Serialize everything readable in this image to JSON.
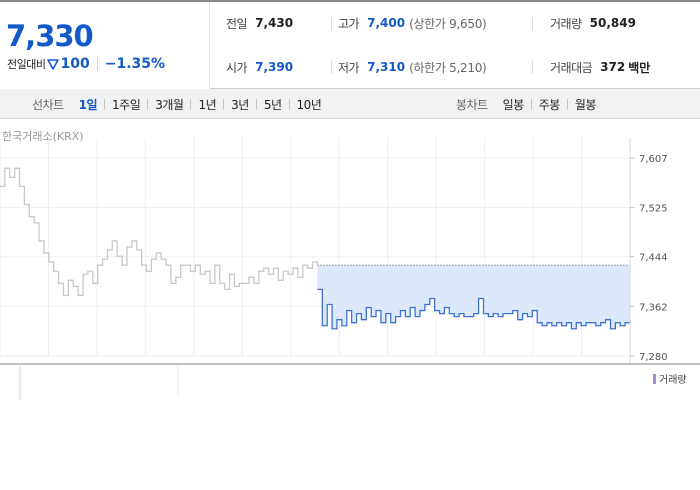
{
  "quote": {
    "current_price": "7,330",
    "change_label": "전일대비",
    "change_value": "100",
    "change_rate": "−1.35%",
    "prev_close_label": "전일",
    "prev_close": "7,430",
    "high_label": "고가",
    "high": "7,400",
    "upper_limit": "(상한가 9,650)",
    "volume_label": "거래량",
    "volume": "50,849",
    "open_label": "시가",
    "open": "7,390",
    "low_label": "저가",
    "low": "7,310",
    "lower_limit": "(하한가 5,210)",
    "amount_label": "거래대금",
    "amount": "372",
    "amount_unit": "백만",
    "colors": {
      "down": "#1259c9",
      "up": "#e33"
    }
  },
  "toolbar": {
    "line_chart_label": "선차트",
    "periods": [
      "1일",
      "1주일",
      "3개월",
      "1년",
      "3년",
      "5년",
      "10년"
    ],
    "active_period": "1일",
    "candle_chart_label": "봉차트",
    "candle_periods": [
      "일봉",
      "주봉",
      "월봉"
    ]
  },
  "chart_data": {
    "type": "line",
    "source_label": "한국거래소(KRX)",
    "ylim": [
      7280,
      7607
    ],
    "yticks": [
      7607,
      7525,
      7444,
      7362,
      7280
    ],
    "prev_close_reference": 7430,
    "grid": true,
    "legend_position": "bottom-right",
    "series": [
      {
        "name": "",
        "color": "#c8c8c8",
        "x": [
          0,
          0.5,
          1,
          1.5,
          2,
          2.5,
          3,
          3.5,
          4,
          4.5,
          5,
          5.5,
          6,
          6.5,
          7,
          7.5,
          8,
          8.5,
          9,
          9.5,
          10,
          10.5,
          11,
          11.5,
          12,
          12.5,
          13,
          13.5,
          14,
          14.5,
          15,
          15.5,
          16,
          16.5,
          17,
          17.5,
          18,
          18.5,
          19,
          19.5,
          20,
          20.5,
          21,
          21.5,
          22,
          22.5,
          23,
          23.5,
          24,
          24.5,
          25,
          25.5,
          26,
          26.5,
          27,
          27.5,
          28,
          28.5,
          29,
          29.5,
          30,
          30.5,
          31,
          31.5,
          32,
          32.5
        ],
        "y": [
          7560,
          7590,
          7575,
          7590,
          7560,
          7530,
          7510,
          7500,
          7470,
          7450,
          7435,
          7420,
          7400,
          7380,
          7405,
          7395,
          7380,
          7415,
          7420,
          7400,
          7430,
          7440,
          7455,
          7470,
          7445,
          7430,
          7460,
          7470,
          7455,
          7430,
          7420,
          7440,
          7450,
          7440,
          7430,
          7400,
          7410,
          7430,
          7430,
          7420,
          7430,
          7415,
          7420,
          7400,
          7430,
          7400,
          7390,
          7415,
          7395,
          7400,
          7400,
          7410,
          7400,
          7420,
          7425,
          7415,
          7425,
          7405,
          7420,
          7415,
          7425,
          7410,
          7430,
          7425,
          7435,
          7430
        ]
      },
      {
        "name": "",
        "color": "#3d74d4",
        "x": [
          32.5,
          33,
          33.5,
          34,
          34.5,
          35,
          35.5,
          36,
          36.5,
          37,
          37.5,
          38,
          38.5,
          39,
          39.5,
          40,
          40.5,
          41,
          41.5,
          42,
          42.5,
          43,
          43.5,
          44,
          44.5,
          45,
          45.5,
          46,
          46.5,
          47,
          47.5,
          48,
          48.5,
          49,
          49.5,
          50,
          50.5,
          51,
          51.5,
          52,
          52.5,
          53,
          53.5,
          54,
          54.5,
          55,
          55.5,
          56,
          56.5,
          57,
          57.5,
          58,
          58.5,
          59,
          59.5,
          60,
          60.5,
          61,
          61.5,
          62,
          62.5,
          63,
          63.5,
          64,
          64.5
        ],
        "y": [
          7390,
          7330,
          7365,
          7325,
          7340,
          7330,
          7355,
          7335,
          7350,
          7340,
          7360,
          7345,
          7355,
          7335,
          7350,
          7335,
          7345,
          7355,
          7345,
          7360,
          7345,
          7355,
          7365,
          7375,
          7355,
          7350,
          7360,
          7350,
          7345,
          7350,
          7345,
          7345,
          7350,
          7375,
          7350,
          7345,
          7350,
          7345,
          7350,
          7350,
          7355,
          7340,
          7350,
          7345,
          7355,
          7335,
          7330,
          7335,
          7330,
          7335,
          7330,
          7335,
          7325,
          7335,
          7330,
          7335,
          7335,
          7330,
          7335,
          7340,
          7325,
          7335,
          7330,
          7335,
          7340
        ]
      }
    ]
  },
  "volume_legend": "거래량"
}
